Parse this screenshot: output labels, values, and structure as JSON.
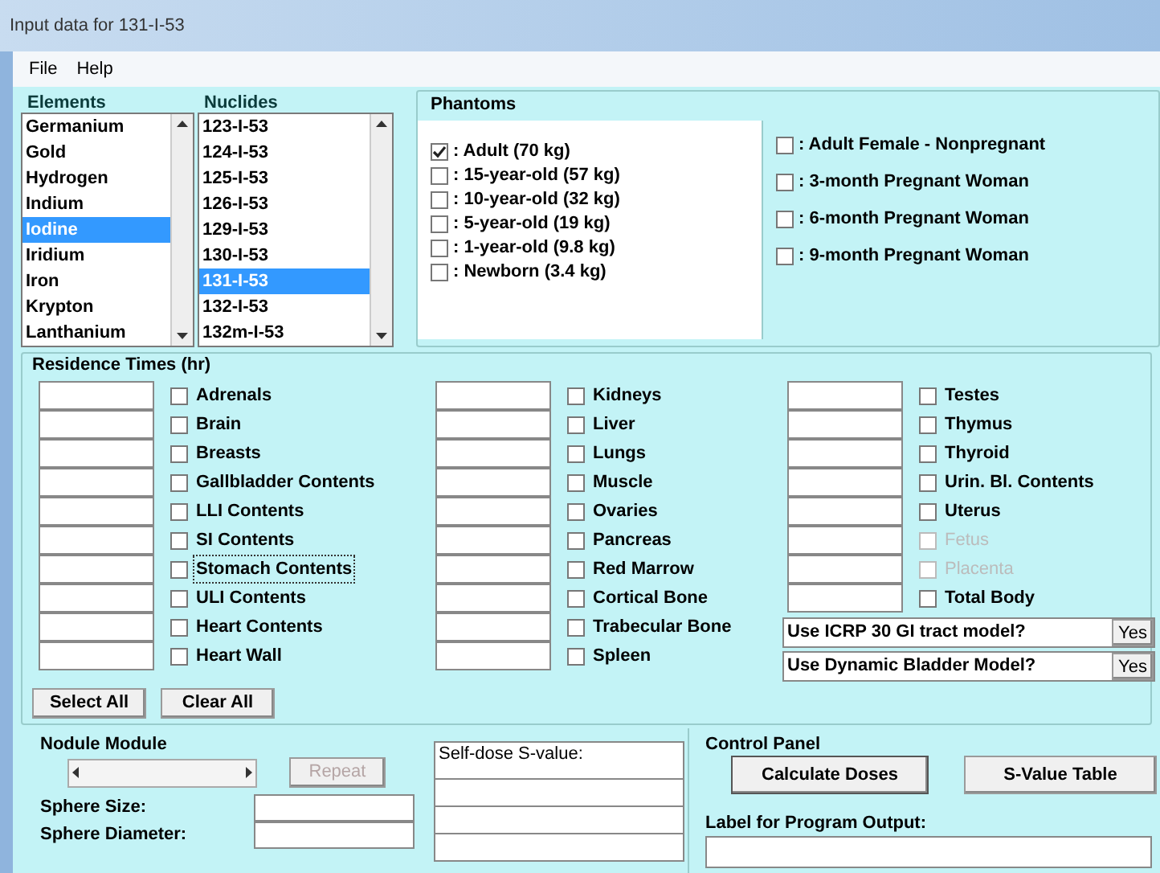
{
  "window": {
    "title": "Input data for 131-I-53"
  },
  "menu": [
    "File",
    "Help"
  ],
  "elements": {
    "label": "Elements",
    "items": [
      {
        "label": "Germanium",
        "selected": false
      },
      {
        "label": "Gold",
        "selected": false
      },
      {
        "label": "Hydrogen",
        "selected": false
      },
      {
        "label": "Indium",
        "selected": false
      },
      {
        "label": "Iodine",
        "selected": true
      },
      {
        "label": "Iridium",
        "selected": false
      },
      {
        "label": "Iron",
        "selected": false
      },
      {
        "label": "Krypton",
        "selected": false
      },
      {
        "label": "Lanthanium",
        "selected": false
      }
    ]
  },
  "nuclides": {
    "label": "Nuclides",
    "items": [
      {
        "label": "123-I-53",
        "selected": false
      },
      {
        "label": "124-I-53",
        "selected": false
      },
      {
        "label": "125-I-53",
        "selected": false
      },
      {
        "label": "126-I-53",
        "selected": false
      },
      {
        "label": "129-I-53",
        "selected": false
      },
      {
        "label": "130-I-53",
        "selected": false
      },
      {
        "label": "131-I-53",
        "selected": true
      },
      {
        "label": "132-I-53",
        "selected": false
      },
      {
        "label": "132m-I-53",
        "selected": false
      }
    ]
  },
  "phantoms": {
    "title": "Phantoms",
    "groups": [
      [
        {
          "label": ": Adult (70 kg)",
          "checked": true
        },
        {
          "label": ": 15-year-old (57 kg)",
          "checked": false
        },
        {
          "label": ": 10-year-old (32 kg)",
          "checked": false
        },
        {
          "label": ": 5-year-old (19 kg)",
          "checked": false
        },
        {
          "label": ": 1-year-old (9.8 kg)",
          "checked": false
        },
        {
          "label": ": Newborn (3.4 kg)",
          "checked": false
        }
      ],
      [
        {
          "label": ": Adult Female - Nonpregnant",
          "checked": false
        },
        {
          "label": ": 3-month Pregnant Woman",
          "checked": false
        },
        {
          "label": ": 6-month Pregnant Woman",
          "checked": false
        },
        {
          "label": ": 9-month Pregnant Woman",
          "checked": false
        }
      ]
    ]
  },
  "residence": {
    "title": "Residence Times (hr)",
    "columns": [
      [
        {
          "label": "Adrenals",
          "checked": false,
          "disabled": false,
          "focused": false
        },
        {
          "label": "Brain",
          "checked": false,
          "disabled": false,
          "focused": false
        },
        {
          "label": "Breasts",
          "checked": false,
          "disabled": false,
          "focused": false
        },
        {
          "label": "Gallbladder Contents",
          "checked": false,
          "disabled": false,
          "focused": false
        },
        {
          "label": "LLI Contents",
          "checked": false,
          "disabled": false,
          "focused": false
        },
        {
          "label": "SI Contents",
          "checked": false,
          "disabled": false,
          "focused": false
        },
        {
          "label": "Stomach Contents",
          "checked": false,
          "disabled": false,
          "focused": true
        },
        {
          "label": "ULI Contents",
          "checked": false,
          "disabled": false,
          "focused": false
        },
        {
          "label": "Heart Contents",
          "checked": false,
          "disabled": false,
          "focused": false
        },
        {
          "label": "Heart Wall",
          "checked": false,
          "disabled": false,
          "focused": false
        }
      ],
      [
        {
          "label": "Kidneys",
          "checked": false,
          "disabled": false,
          "focused": false
        },
        {
          "label": "Liver",
          "checked": false,
          "disabled": false,
          "focused": false
        },
        {
          "label": "Lungs",
          "checked": false,
          "disabled": false,
          "focused": false
        },
        {
          "label": "Muscle",
          "checked": false,
          "disabled": false,
          "focused": false
        },
        {
          "label": "Ovaries",
          "checked": false,
          "disabled": false,
          "focused": false
        },
        {
          "label": "Pancreas",
          "checked": false,
          "disabled": false,
          "focused": false
        },
        {
          "label": "Red Marrow",
          "checked": false,
          "disabled": false,
          "focused": false
        },
        {
          "label": "Cortical Bone",
          "checked": false,
          "disabled": false,
          "focused": false
        },
        {
          "label": "Trabecular Bone",
          "checked": false,
          "disabled": false,
          "focused": false
        },
        {
          "label": "Spleen",
          "checked": false,
          "disabled": false,
          "focused": false
        }
      ],
      [
        {
          "label": "Testes",
          "checked": false,
          "disabled": false,
          "focused": false
        },
        {
          "label": "Thymus",
          "checked": false,
          "disabled": false,
          "focused": false
        },
        {
          "label": "Thyroid",
          "checked": false,
          "disabled": false,
          "focused": false
        },
        {
          "label": "Urin. Bl. Contents",
          "checked": false,
          "disabled": false,
          "focused": false
        },
        {
          "label": "Uterus",
          "checked": false,
          "disabled": false,
          "focused": false
        },
        {
          "label": "Fetus",
          "checked": false,
          "disabled": true,
          "focused": false
        },
        {
          "label": "Placenta",
          "checked": false,
          "disabled": true,
          "focused": false
        },
        {
          "label": "Total Body",
          "checked": false,
          "disabled": false,
          "focused": false
        }
      ]
    ],
    "buttons": [
      "Select All",
      "Clear All"
    ],
    "options": [
      {
        "label": "Use ICRP 30 GI tract model?",
        "value": "Yes"
      },
      {
        "label": "Use Dynamic Bladder Model?",
        "value": "Yes"
      }
    ]
  },
  "nodule": {
    "title": "Nodule Module",
    "button": {
      "label": "Repeat",
      "disabled": true
    },
    "fields": [
      "Sphere Size:",
      "Sphere Diameter:"
    ]
  },
  "s_value": {
    "label": "Self-dose S-value:"
  },
  "control_panel": {
    "title": "Control Panel",
    "buttons": [
      "Calculate Doses",
      "S-Value Table"
    ],
    "output_label": "Label for Program Output:"
  }
}
